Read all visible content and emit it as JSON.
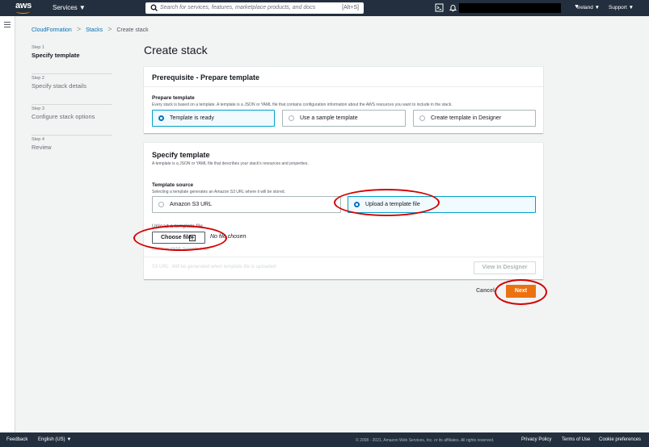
{
  "topnav": {
    "logo_text": "aws",
    "services_label": "Services ▼",
    "search_placeholder": "Search for services, features, marketplace products, and docs",
    "search_shortcut": "[Alt+S]",
    "region_label": "Ireland ▼",
    "support_label": "Support ▼",
    "account_caret": "▼"
  },
  "breadcrumb": {
    "items": [
      "CloudFormation",
      "Stacks",
      "Create stack"
    ],
    "separator": ">"
  },
  "steps": [
    {
      "num": "Step 1",
      "name": "Specify template"
    },
    {
      "num": "Step 2",
      "name": "Specify stack details"
    },
    {
      "num": "Step 3",
      "name": "Configure stack options"
    },
    {
      "num": "Step 4",
      "name": "Review"
    }
  ],
  "page_title": "Create stack",
  "prerequisite": {
    "header": "Prerequisite - Prepare template",
    "label": "Prepare template",
    "description": "Every stack is based on a template. A template is a JSON or YAML file that contains configuration information about the AWS resources you want to include in the stack.",
    "options": [
      "Template is ready",
      "Use a sample template",
      "Create template in Designer"
    ],
    "selected": "Template is ready"
  },
  "specify": {
    "header": "Specify template",
    "description": "A template is a JSON or YAML file that describes your stack's resources and properties.",
    "source_label": "Template source",
    "source_description": "Selecting a template generates an Amazon S3 URL where it will be stored.",
    "options": [
      "Amazon S3 URL",
      "Upload a template file"
    ],
    "selected": "Upload a template file",
    "upload_label": "Upload a template file",
    "choose_file_label": "Choose file",
    "no_file_text": "No file chosen",
    "hint": "JSON or YAML formatted file",
    "s3_url_label": "S3 URL:",
    "s3_url_value": "Will be generated when template file is uploaded",
    "view_designer_label": "View in Designer"
  },
  "actions": {
    "cancel_label": "Cancel",
    "next_label": "Next"
  },
  "footer": {
    "feedback": "Feedback",
    "language": "English (US) ▼",
    "copyright": "© 2008 - 2021, Amazon Web Services, Inc. or its affiliates. All rights reserved.",
    "privacy": "Privacy Policy",
    "terms": "Terms of Use",
    "cookies": "Cookie preferences"
  },
  "colors": {
    "nav_bg": "#232f3e",
    "link": "#0073bb",
    "primary_button": "#ec7211",
    "selected_tile_border": "#00a1c9",
    "annotation": "#d40000"
  }
}
